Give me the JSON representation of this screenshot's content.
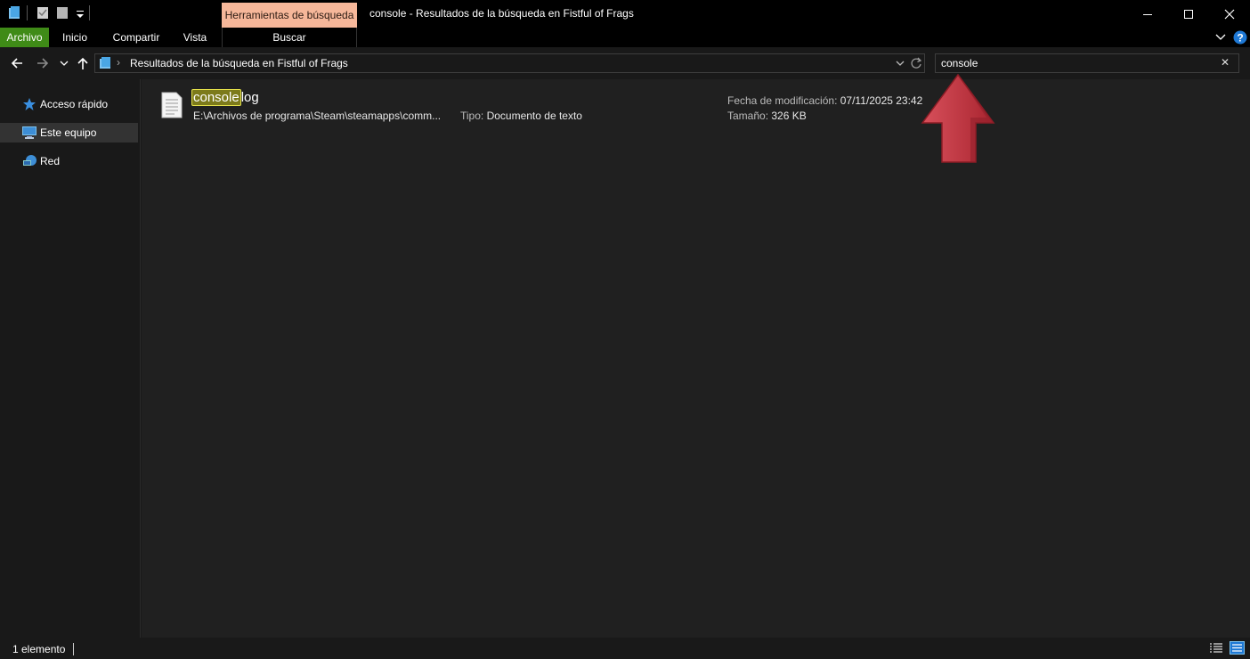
{
  "window": {
    "title": "console - Resultados de la búsqueda en Fistful of Frags",
    "context_tab": "Herramientas de búsqueda",
    "controls": [
      "minimize-icon",
      "maximize-icon",
      "close-icon"
    ]
  },
  "ribbon": {
    "tabs": [
      "Archivo",
      "Inicio",
      "Compartir",
      "Vista"
    ],
    "context_tab": "Buscar",
    "accent": "#3f8b17",
    "context_color": "#f6b79a"
  },
  "address": {
    "path": "Resultados de la búsqueda en Fistful of Frags",
    "separator": "›"
  },
  "search": {
    "value": "console",
    "clear_glyph": "✕"
  },
  "sidebar": {
    "items": [
      {
        "label": "Acceso rápido",
        "icon": "star-icon"
      },
      {
        "label": "Este equipo",
        "icon": "computer-icon",
        "selected": true
      },
      {
        "label": "Red",
        "icon": "network-icon"
      }
    ]
  },
  "results": [
    {
      "name_match": "console",
      "name_rest": "log",
      "path": "E:\\Archivos de programa\\Steam\\steamapps\\comm...",
      "type_label": "Tipo:",
      "type_value": "Documento de texto",
      "modified_label": "Fecha de modificación:",
      "modified_value": "07/11/2025 23:42",
      "size_label": "Tamaño:",
      "size_value": "326 KB"
    }
  ],
  "status": {
    "count": "1 elemento"
  },
  "annotation": {
    "arrow_color": "#c8323f"
  }
}
